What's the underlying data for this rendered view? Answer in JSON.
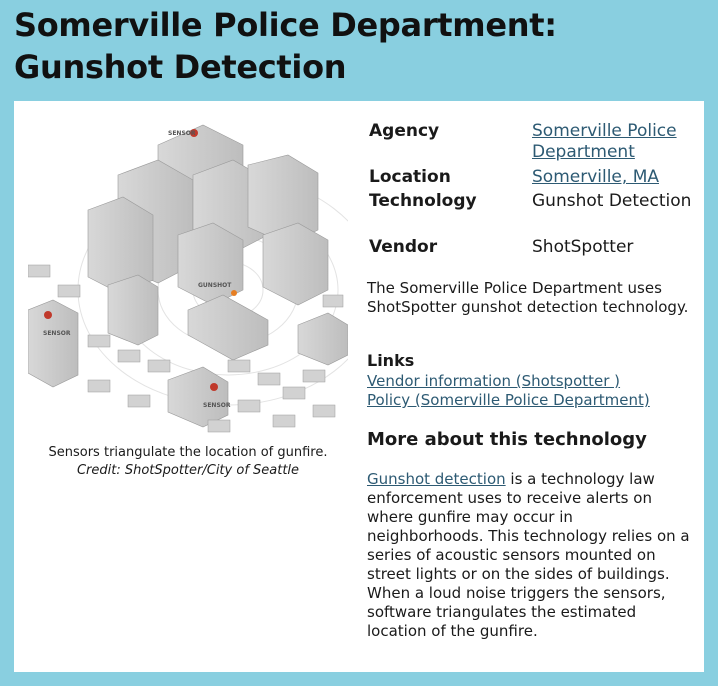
{
  "page": {
    "title": "Somerville Police Department: Gunshot Detection"
  },
  "illustration": {
    "labels": [
      "SENSOR",
      "SENSOR",
      "GUNSHOT",
      "SENSOR"
    ],
    "caption": "Sensors triangulate the location of gunfire.",
    "credit": "Credit: ShotSpotter/City of Seattle"
  },
  "info": {
    "agency_label": "Agency",
    "agency_value": "Somerville Police Department",
    "location_label": "Location",
    "location_value": "Somerville, MA",
    "technology_label": "Technology",
    "technology_value": "Gunshot Detection",
    "vendor_label": "Vendor",
    "vendor_value": "ShotSpotter"
  },
  "description": "The Somerville Police Department uses ShotSpotter gunshot detection technology.",
  "links": {
    "heading": "Links",
    "items": [
      "Vendor information (Shotspotter )",
      "Policy (Somerville Police Department)"
    ]
  },
  "more": {
    "heading": "More about this technology",
    "link_text": "Gunshot detection",
    "text": " is a technology law enforcement uses to receive alerts on where gunfire may occur in neighborhoods. This technology relies on a series of acoustic sensors mounted on street lights or on the sides of buildings. When a loud noise triggers the sensors, software triangulates the estimated location of the gunfire."
  },
  "colors": {
    "background": "#89cfe0",
    "card": "#ffffff",
    "link": "#2d5a73",
    "sensor": "#c0392b"
  }
}
